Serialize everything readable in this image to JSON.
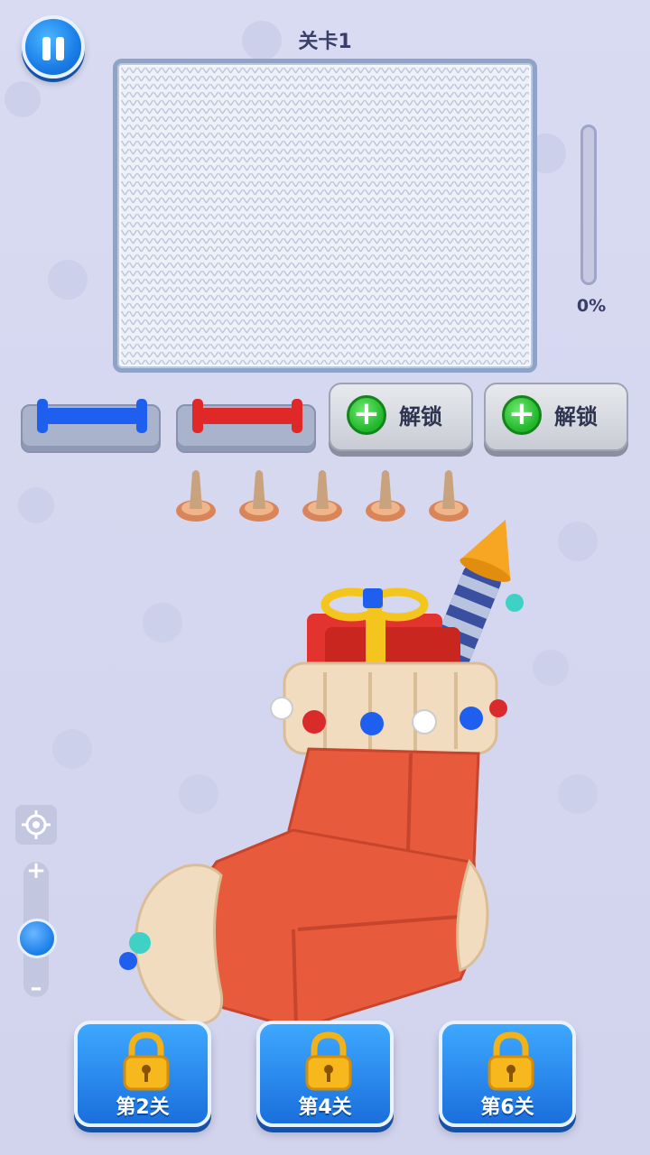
{
  "header": {
    "level_title": "关卡1"
  },
  "progress": {
    "value": 0,
    "text": "0%"
  },
  "spools": [
    {
      "color": "#1e5ff0"
    },
    {
      "color": "#e02828"
    }
  ],
  "unlock_slots": [
    {
      "label": "解锁"
    },
    {
      "label": "解锁"
    }
  ],
  "pegs_count": 5,
  "zoom": {
    "plus": "+",
    "minus": "–",
    "level": 0.55
  },
  "level_buttons": [
    {
      "label": "第2关"
    },
    {
      "label": "第4关"
    },
    {
      "label": "第6关"
    }
  ],
  "colors": {
    "accent": "#1a7de8",
    "sock": "#e85a3c",
    "cuff": "#f2dcc0"
  }
}
